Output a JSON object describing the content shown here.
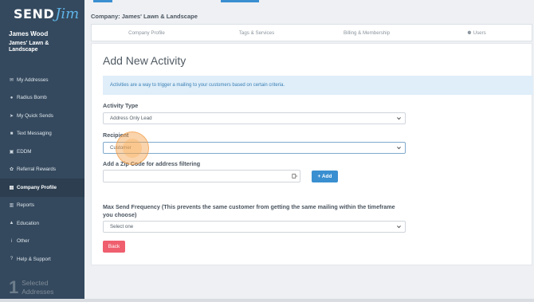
{
  "brand": {
    "send": "SEND",
    "jim": "Jim"
  },
  "user": {
    "name": "James Wood",
    "company": "James' Lawn & Landscape"
  },
  "nav": [
    {
      "label": "My Addresses",
      "icon": "envelope-icon",
      "glyph": "✉"
    },
    {
      "label": "Radius Bomb",
      "icon": "map-pin-icon",
      "glyph": "●"
    },
    {
      "label": "My Quick Sends",
      "icon": "send-icon",
      "glyph": "➤"
    },
    {
      "label": "Text Messaging",
      "icon": "chat-icon",
      "glyph": "■"
    },
    {
      "label": "EDDM",
      "icon": "mailbox-icon",
      "glyph": "▣"
    },
    {
      "label": "Referral Rewards",
      "icon": "gift-icon",
      "glyph": "✿"
    },
    {
      "label": "Company Profile",
      "icon": "building-icon",
      "glyph": "▤"
    },
    {
      "label": "Reports",
      "icon": "report-icon",
      "glyph": "▥"
    },
    {
      "label": "Education",
      "icon": "education-icon",
      "glyph": "▲"
    },
    {
      "label": "Other",
      "icon": "info-icon",
      "glyph": "i"
    },
    {
      "label": "Help & Support",
      "icon": "help-icon",
      "glyph": "?"
    }
  ],
  "active_nav": "Company Profile",
  "selected": {
    "count": "1",
    "label_line1": "Selected",
    "label_line2": "Addresses"
  },
  "header": {
    "company": "Company: James' Lawn & Landscape"
  },
  "tabs": [
    {
      "label": "Company Profile"
    },
    {
      "label": "Tags & Services"
    },
    {
      "label": "Billing & Membership"
    },
    {
      "label": "Users",
      "icon": "users-icon"
    }
  ],
  "form": {
    "title": "Add New Activity",
    "info": "Activities are a way to trigger a mailing to your customers based on certain criteria.",
    "activity_type_label": "Activity Type",
    "activity_type_value": "Address Only Lead",
    "recipient_label": "Recipient",
    "recipient_value": "Customer",
    "zip_label": "Add a Zip Code for address filtering",
    "zip_value": "",
    "add_button": "+ Add",
    "freq_label": "Max Send Frequency (This prevents the same customer from getting the same mailing within the timeframe you choose)",
    "freq_value": "Select one",
    "back_button": "Back"
  },
  "colors": {
    "sidebar": "#34495e",
    "accent": "#3a8fd1",
    "danger": "#ef5f6e",
    "info_bg": "#dfeef9"
  }
}
